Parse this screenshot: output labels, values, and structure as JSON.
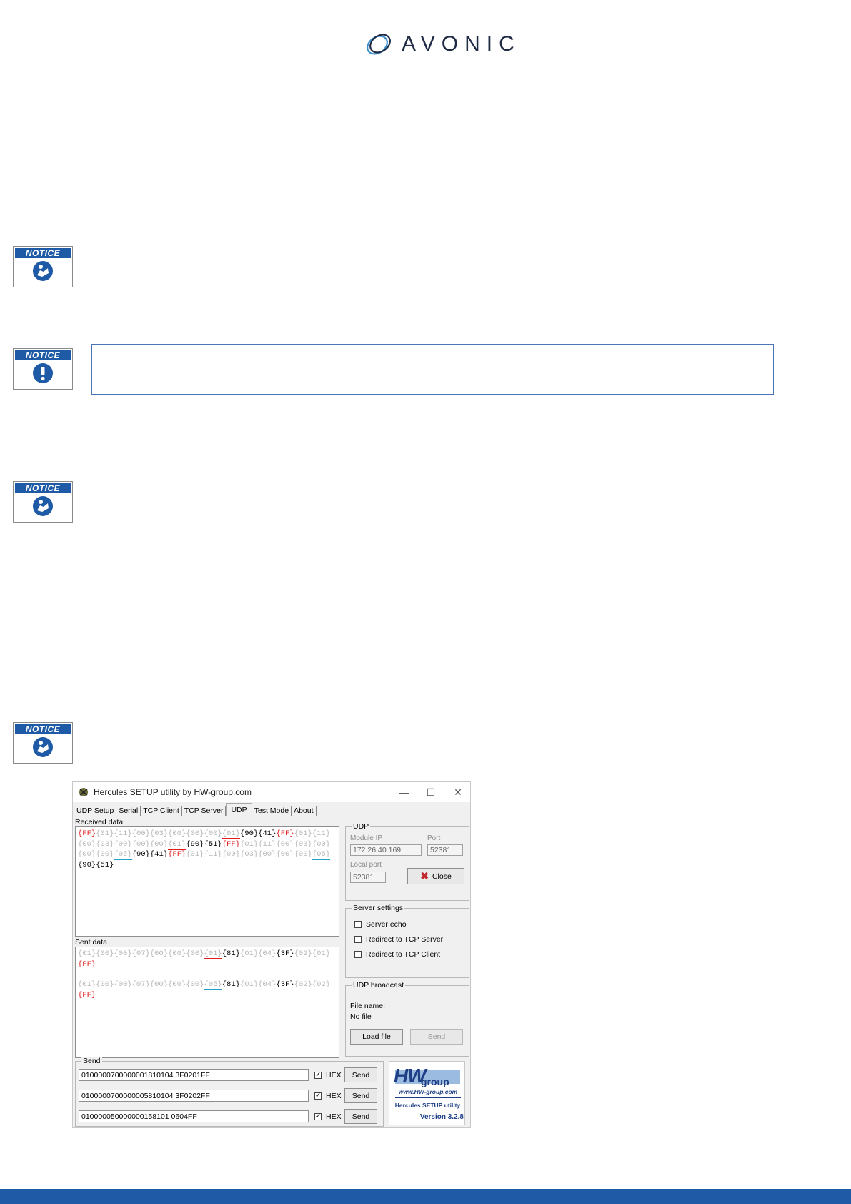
{
  "brand": {
    "name": "AVONIC"
  },
  "notices": [
    {
      "label": "NOTICE",
      "icon": "manual-icon"
    },
    {
      "label": "NOTICE",
      "icon": "exclamation-icon"
    },
    {
      "label": "NOTICE",
      "icon": "manual-icon"
    },
    {
      "label": "NOTICE",
      "icon": "manual-icon"
    }
  ],
  "colors": {
    "brand_blue": "#1e5aa6",
    "hex_red": "#e21c1c",
    "hex_blue_underline": "#1ea0c8"
  },
  "hercules": {
    "title": "Hercules SETUP utility by HW-group.com",
    "controls": {
      "minimize": "—",
      "maximize": "☐",
      "close": "✕"
    },
    "tabs": [
      "UDP Setup",
      "Serial",
      "TCP Client",
      "TCP Server",
      "UDP",
      "Test Mode",
      "About"
    ],
    "received_label": "Received data",
    "received_tokens": [
      {
        "t": "{FF}",
        "c": "r"
      },
      {
        "t": "{01}",
        "c": "g"
      },
      {
        "t": "{11}",
        "c": "g"
      },
      {
        "t": "{00}",
        "c": "g"
      },
      {
        "t": "{03}",
        "c": "g"
      },
      {
        "t": "{00}",
        "c": "g"
      },
      {
        "t": "{00}",
        "c": "g"
      },
      {
        "t": "{00}",
        "c": "g"
      },
      {
        "t": "{01}",
        "c": "g",
        "u": "red"
      },
      {
        "t": "{90}",
        "c": "k"
      },
      {
        "t": "{41}",
        "c": "k"
      },
      {
        "t": "{FF}",
        "c": "r"
      },
      {
        "t": "{01}",
        "c": "g"
      },
      {
        "t": "{11}",
        "c": "g"
      },
      {
        "t": "{00}",
        "c": "g"
      },
      {
        "t": "{03}",
        "c": "g"
      },
      {
        "t": "{00}",
        "c": "g"
      },
      {
        "t": "{00}",
        "c": "g"
      },
      {
        "t": "{00}",
        "c": "g"
      },
      {
        "t": "{01}",
        "c": "g",
        "u": "red"
      },
      {
        "t": "{90}",
        "c": "k"
      },
      {
        "t": "{51}",
        "c": "k"
      },
      {
        "t": "{FF}",
        "c": "r"
      },
      {
        "t": "{01}",
        "c": "g"
      },
      {
        "t": "{11}",
        "c": "g"
      },
      {
        "t": "{00}",
        "c": "g"
      },
      {
        "t": "{03}",
        "c": "g"
      },
      {
        "t": "{00}",
        "c": "g"
      },
      {
        "t": "{00}",
        "c": "g"
      },
      {
        "t": "{00}",
        "c": "g"
      },
      {
        "t": "{05}",
        "c": "g",
        "u": "blue"
      },
      {
        "t": "{90}",
        "c": "k"
      },
      {
        "t": "{41}",
        "c": "k"
      },
      {
        "t": "{FF}",
        "c": "r"
      },
      {
        "t": "{01}",
        "c": "g"
      },
      {
        "t": "{11}",
        "c": "g"
      },
      {
        "t": "{00}",
        "c": "g"
      },
      {
        "t": "{03}",
        "c": "g"
      },
      {
        "t": "{00}",
        "c": "g"
      },
      {
        "t": "{00}",
        "c": "g"
      },
      {
        "t": "{00}",
        "c": "g"
      },
      {
        "t": "{05}",
        "c": "g",
        "u": "blue"
      },
      {
        "t": "{90}",
        "c": "k"
      },
      {
        "t": "{51}",
        "c": "k"
      }
    ],
    "sent_label": "Sent data",
    "sent_blocks": [
      [
        {
          "t": "{01}",
          "c": "g"
        },
        {
          "t": "{00}",
          "c": "g"
        },
        {
          "t": "{00}",
          "c": "g"
        },
        {
          "t": "{07}",
          "c": "g"
        },
        {
          "t": "{00}",
          "c": "g"
        },
        {
          "t": "{00}",
          "c": "g"
        },
        {
          "t": "{00}",
          "c": "g"
        },
        {
          "t": "{01}",
          "c": "g",
          "u": "red"
        },
        {
          "t": "{81}",
          "c": "k"
        },
        {
          "t": "{01}",
          "c": "g"
        },
        {
          "t": "{04}",
          "c": "g"
        },
        {
          "t": "{3F}",
          "c": "k"
        },
        {
          "t": "{02}",
          "c": "g"
        },
        {
          "t": "{01}",
          "c": "g"
        },
        {
          "t": "{FF}",
          "c": "r"
        }
      ],
      [
        {
          "t": "{01}",
          "c": "g"
        },
        {
          "t": "{00}",
          "c": "g"
        },
        {
          "t": "{00}",
          "c": "g"
        },
        {
          "t": "{07}",
          "c": "g"
        },
        {
          "t": "{00}",
          "c": "g"
        },
        {
          "t": "{00}",
          "c": "g"
        },
        {
          "t": "{00}",
          "c": "g"
        },
        {
          "t": "{05}",
          "c": "g",
          "u": "blue"
        },
        {
          "t": "{81}",
          "c": "k"
        },
        {
          "t": "{01}",
          "c": "g"
        },
        {
          "t": "{04}",
          "c": "g"
        },
        {
          "t": "{3F}",
          "c": "k"
        },
        {
          "t": "{02}",
          "c": "g"
        },
        {
          "t": "{02}",
          "c": "g"
        },
        {
          "t": "{FF}",
          "c": "r"
        }
      ]
    ],
    "udp": {
      "group_title": "UDP",
      "module_ip_label": "Module IP",
      "module_ip": "172.26.40.169",
      "port_label": "Port",
      "port": "52381",
      "local_port_label": "Local port",
      "local_port": "52381",
      "close_label": "Close"
    },
    "server_settings": {
      "group_title": "Server settings",
      "options": [
        "Server echo",
        "Redirect to TCP Server",
        "Redirect to TCP Client"
      ]
    },
    "udp_broadcast": {
      "group_title": "UDP broadcast",
      "file_name_label": "File name:",
      "file_value": "No file",
      "load_label": "Load file",
      "send_label": "Send"
    },
    "send_group": {
      "title": "Send",
      "rows": [
        {
          "value": "0100000700000001810104 3F0201FF",
          "hex_label": "HEX",
          "send_label": "Send"
        },
        {
          "value": "0100000700000005810104 3F0202FF",
          "hex_label": "HEX",
          "send_label": "Send"
        },
        {
          "value": "010000050000000158101 0604FF",
          "hex_label": "HEX",
          "send_label": "Send"
        }
      ]
    },
    "hw_logo": {
      "big": "HW",
      "group": "group",
      "url": "www.HW-group.com",
      "utility": "Hercules SETUP utility",
      "version": "Version  3.2.8"
    }
  }
}
